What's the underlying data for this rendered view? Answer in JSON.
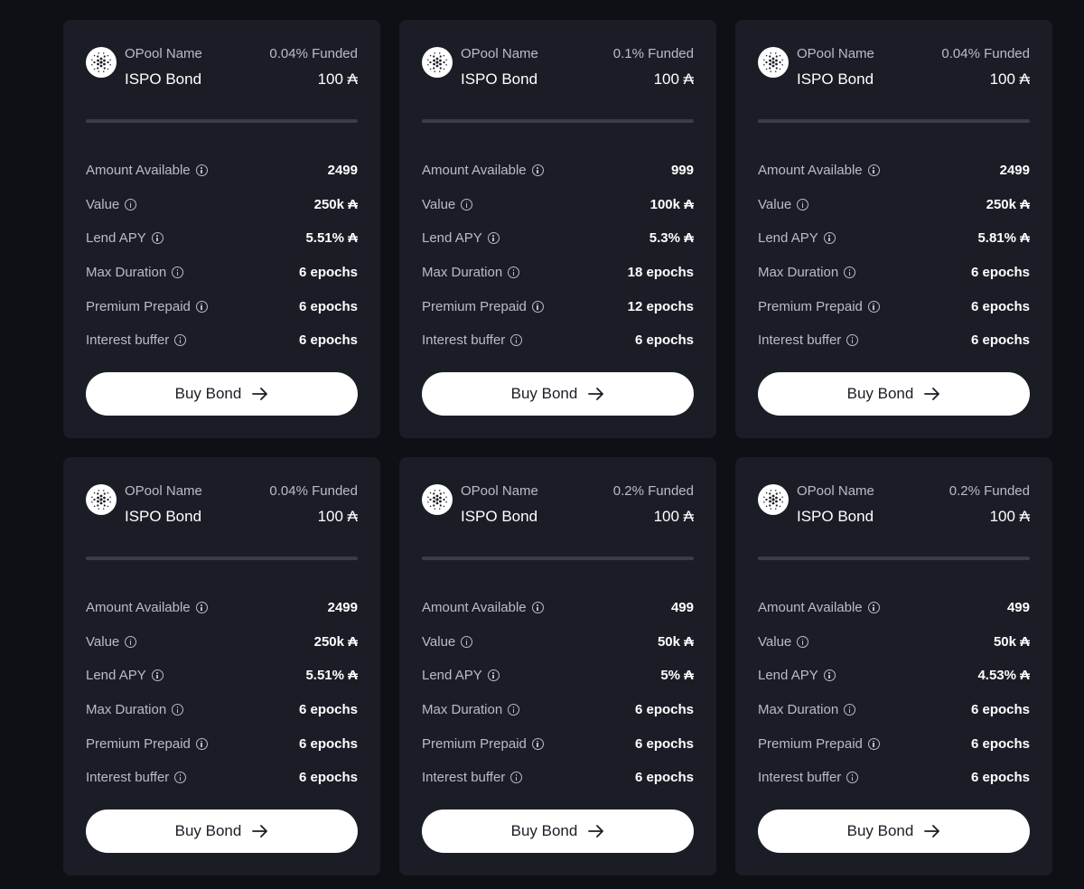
{
  "colors": {
    "background": "#0f1015",
    "card": "#1b1d26",
    "label": "#b9bcc8",
    "divider": "#3a3d48",
    "button": "#ffffff"
  },
  "icons": {
    "logo": "cardano-icon",
    "info": "info-icon",
    "button": "arrow-right-icon"
  },
  "cards": [
    {
      "pool_label": "OPool Name",
      "pool_name": "ISPO Bond",
      "funded": "0.04% Funded",
      "price": "100 ₳",
      "rows": [
        {
          "label": "Amount Available",
          "value": "2499"
        },
        {
          "label": "Value",
          "value": "250k ₳"
        },
        {
          "label": "Lend APY",
          "value": "5.51% ₳"
        },
        {
          "label": "Max Duration",
          "value": "6 epochs"
        },
        {
          "label": "Premium Prepaid",
          "value": "6 epochs"
        },
        {
          "label": "Interest buffer",
          "value": "6 epochs"
        }
      ],
      "button": "Buy Bond"
    },
    {
      "pool_label": "OPool Name",
      "pool_name": "ISPO Bond",
      "funded": "0.1% Funded",
      "price": "100 ₳",
      "rows": [
        {
          "label": "Amount Available",
          "value": "999"
        },
        {
          "label": "Value",
          "value": "100k ₳"
        },
        {
          "label": "Lend APY",
          "value": "5.3% ₳"
        },
        {
          "label": "Max Duration",
          "value": "18 epochs"
        },
        {
          "label": "Premium Prepaid",
          "value": "12 epochs"
        },
        {
          "label": "Interest buffer",
          "value": "6 epochs"
        }
      ],
      "button": "Buy Bond"
    },
    {
      "pool_label": "OPool Name",
      "pool_name": "ISPO Bond",
      "funded": "0.04% Funded",
      "price": "100 ₳",
      "rows": [
        {
          "label": "Amount Available",
          "value": "2499"
        },
        {
          "label": "Value",
          "value": "250k ₳"
        },
        {
          "label": "Lend APY",
          "value": "5.81% ₳"
        },
        {
          "label": "Max Duration",
          "value": "6 epochs"
        },
        {
          "label": "Premium Prepaid",
          "value": "6 epochs"
        },
        {
          "label": "Interest buffer",
          "value": "6 epochs"
        }
      ],
      "button": "Buy Bond"
    },
    {
      "pool_label": "OPool Name",
      "pool_name": "ISPO Bond",
      "funded": "0.04% Funded",
      "price": "100 ₳",
      "rows": [
        {
          "label": "Amount Available",
          "value": "2499"
        },
        {
          "label": "Value",
          "value": "250k ₳"
        },
        {
          "label": "Lend APY",
          "value": "5.51% ₳"
        },
        {
          "label": "Max Duration",
          "value": "6 epochs"
        },
        {
          "label": "Premium Prepaid",
          "value": "6 epochs"
        },
        {
          "label": "Interest buffer",
          "value": "6 epochs"
        }
      ],
      "button": "Buy Bond"
    },
    {
      "pool_label": "OPool Name",
      "pool_name": "ISPO Bond",
      "funded": "0.2% Funded",
      "price": "100 ₳",
      "rows": [
        {
          "label": "Amount Available",
          "value": "499"
        },
        {
          "label": "Value",
          "value": "50k ₳"
        },
        {
          "label": "Lend APY",
          "value": "5% ₳"
        },
        {
          "label": "Max Duration",
          "value": "6 epochs"
        },
        {
          "label": "Premium Prepaid",
          "value": "6 epochs"
        },
        {
          "label": "Interest buffer",
          "value": "6 epochs"
        }
      ],
      "button": "Buy Bond"
    },
    {
      "pool_label": "OPool Name",
      "pool_name": "ISPO Bond",
      "funded": "0.2% Funded",
      "price": "100 ₳",
      "rows": [
        {
          "label": "Amount Available",
          "value": "499"
        },
        {
          "label": "Value",
          "value": "50k ₳"
        },
        {
          "label": "Lend APY",
          "value": "4.53% ₳"
        },
        {
          "label": "Max Duration",
          "value": "6 epochs"
        },
        {
          "label": "Premium Prepaid",
          "value": "6 epochs"
        },
        {
          "label": "Interest buffer",
          "value": "6 epochs"
        }
      ],
      "button": "Buy Bond"
    }
  ]
}
